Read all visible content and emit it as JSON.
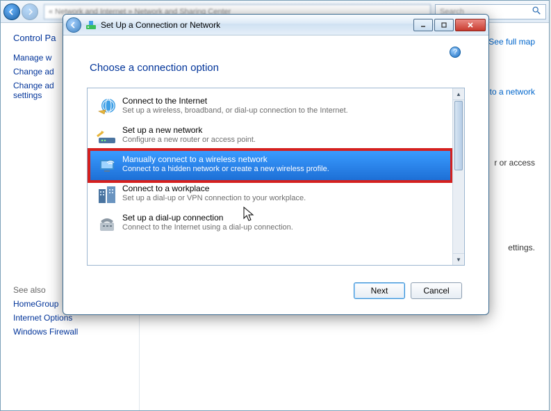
{
  "parent": {
    "address_blur": "« Network and Internet » Network and Sharing Center",
    "search_placeholder": "Search",
    "sidebar": {
      "heading": "Control Pa",
      "links_top": [
        "Manage w",
        "Change ad",
        "Change ad\nsettings"
      ],
      "see_also_label": "See also",
      "links_bottom": [
        "HomeGroup",
        "Internet Options",
        "Windows Firewall"
      ]
    },
    "main": {
      "line1_right": "See full map",
      "line2_right": "to a network",
      "line3_right": "r or access",
      "line4_right": "ettings."
    }
  },
  "wizard": {
    "title": "Set Up a Connection or Network",
    "heading": "Choose a connection option",
    "options": [
      {
        "title": "Connect to the Internet",
        "desc": "Set up a wireless, broadband, or dial-up connection to the Internet.",
        "icon": "globe-icon"
      },
      {
        "title": "Set up a new network",
        "desc": "Configure a new router or access point.",
        "icon": "router-icon"
      },
      {
        "title": "Manually connect to a wireless network",
        "desc": "Connect to a hidden network or create a new wireless profile.",
        "icon": "monitor-wifi-icon",
        "selected": true,
        "highlight": true
      },
      {
        "title": "Connect to a workplace",
        "desc": "Set up a dial-up or VPN connection to your workplace.",
        "icon": "buildings-icon"
      },
      {
        "title": "Set up a dial-up connection",
        "desc": "Connect to the Internet using a dial-up connection.",
        "icon": "phone-modem-icon"
      }
    ],
    "buttons": {
      "next": "Next",
      "cancel": "Cancel"
    }
  }
}
